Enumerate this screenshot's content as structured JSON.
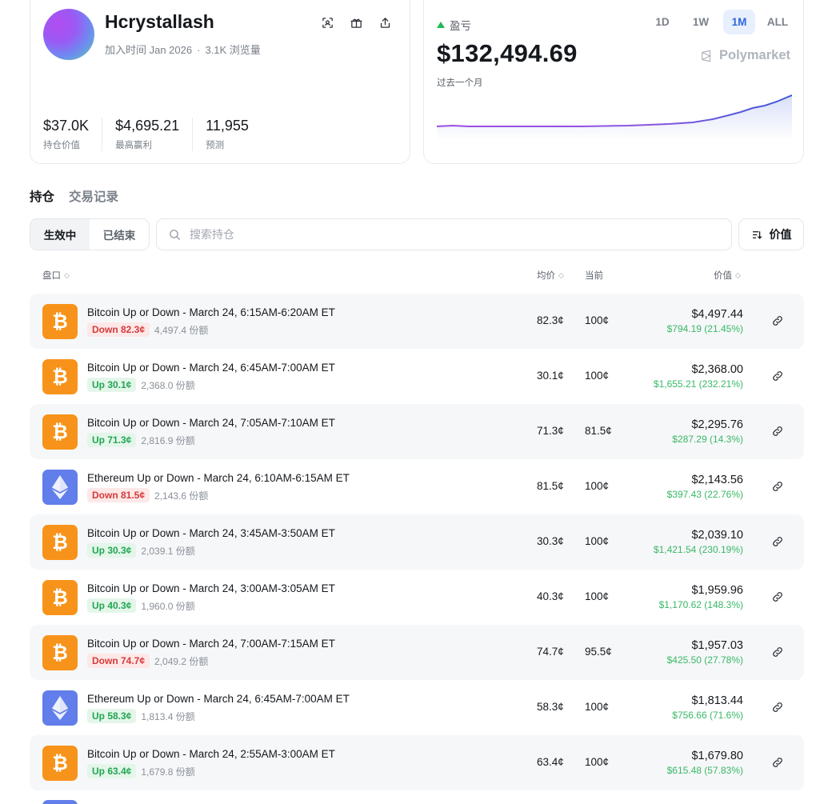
{
  "profile": {
    "username": "Hcrystallash",
    "joined": "加入时间 Jan 2026",
    "views": "3.1K 浏览量",
    "stats": [
      {
        "value": "$37.0K",
        "label": "持仓价值"
      },
      {
        "value": "$4,695.21",
        "label": "最高赢利"
      },
      {
        "value": "11,955",
        "label": "预测"
      }
    ],
    "icons": [
      "scan-icon",
      "gift-icon",
      "share-icon"
    ]
  },
  "pnl": {
    "label": "盈亏",
    "amount": "$132,494.69",
    "period": "过去一个月",
    "ranges": [
      "1D",
      "1W",
      "1M",
      "ALL"
    ],
    "active_range": "1M",
    "brand": "Polymarket",
    "trend_color": "#3b5bd6",
    "up_color": "#22b85a"
  },
  "tabs": {
    "positions": "持仓",
    "history": "交易记录"
  },
  "filters": {
    "active": "生效中",
    "closed": "已结束"
  },
  "search": {
    "placeholder": "搜索持仓"
  },
  "sort": {
    "label": "价值"
  },
  "table": {
    "headers": {
      "market": "盘口",
      "avg": "均价",
      "current": "当前",
      "value": "价值"
    },
    "rows": [
      {
        "coin": "btc",
        "title": "Bitcoin Up or Down - March 24, 6:15AM-6:20AM ET",
        "side": "Down 82.3¢",
        "dir": "down",
        "shares": "4,497.4 份额",
        "avg": "82.3¢",
        "current": "100¢",
        "value": "$4,497.44",
        "gain": "$794.19 (21.45%)"
      },
      {
        "coin": "btc",
        "title": "Bitcoin Up or Down - March 24, 6:45AM-7:00AM ET",
        "side": "Up 30.1¢",
        "dir": "up",
        "shares": "2,368.0 份额",
        "avg": "30.1¢",
        "current": "100¢",
        "value": "$2,368.00",
        "gain": "$1,655.21 (232.21%)"
      },
      {
        "coin": "btc",
        "title": "Bitcoin Up or Down - March 24, 7:05AM-7:10AM ET",
        "side": "Up 71.3¢",
        "dir": "up",
        "shares": "2,816.9 份额",
        "avg": "71.3¢",
        "current": "81.5¢",
        "value": "$2,295.76",
        "gain": "$287.29 (14.3%)"
      },
      {
        "coin": "eth",
        "title": "Ethereum Up or Down - March 24, 6:10AM-6:15AM ET",
        "side": "Down 81.5¢",
        "dir": "down",
        "shares": "2,143.6 份额",
        "avg": "81.5¢",
        "current": "100¢",
        "value": "$2,143.56",
        "gain": "$397.43 (22.76%)"
      },
      {
        "coin": "btc",
        "title": "Bitcoin Up or Down - March 24, 3:45AM-3:50AM ET",
        "side": "Up 30.3¢",
        "dir": "up",
        "shares": "2,039.1 份额",
        "avg": "30.3¢",
        "current": "100¢",
        "value": "$2,039.10",
        "gain": "$1,421.54 (230.19%)"
      },
      {
        "coin": "btc",
        "title": "Bitcoin Up or Down - March 24, 3:00AM-3:05AM ET",
        "side": "Up 40.3¢",
        "dir": "up",
        "shares": "1,960.0 份额",
        "avg": "40.3¢",
        "current": "100¢",
        "value": "$1,959.96",
        "gain": "$1,170.62 (148.3%)"
      },
      {
        "coin": "btc",
        "title": "Bitcoin Up or Down - March 24, 7:00AM-7:15AM ET",
        "side": "Down 74.7¢",
        "dir": "down",
        "shares": "2,049.2 份额",
        "avg": "74.7¢",
        "current": "95.5¢",
        "value": "$1,957.03",
        "gain": "$425.50 (27.78%)"
      },
      {
        "coin": "eth",
        "title": "Ethereum Up or Down - March 24, 6:45AM-7:00AM ET",
        "side": "Up 58.3¢",
        "dir": "up",
        "shares": "1,813.4 份额",
        "avg": "58.3¢",
        "current": "100¢",
        "value": "$1,813.44",
        "gain": "$756.66 (71.6%)"
      },
      {
        "coin": "btc",
        "title": "Bitcoin Up or Down - March 24, 2:55AM-3:00AM ET",
        "side": "Up 63.4¢",
        "dir": "up",
        "shares": "1,679.8 份额",
        "avg": "63.4¢",
        "current": "100¢",
        "value": "$1,679.80",
        "gain": "$615.48 (57.83%)"
      }
    ]
  }
}
